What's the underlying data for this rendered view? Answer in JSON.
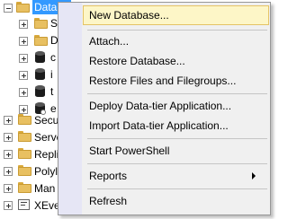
{
  "tree": {
    "selected": "Databa",
    "children_visible": [
      "S",
      "D",
      "c",
      "i",
      "t",
      "e"
    ],
    "siblings_visible": [
      "Secu",
      "Serve",
      "Repli",
      "Polyl",
      "Man",
      "XEve"
    ]
  },
  "context_menu": {
    "items": [
      {
        "label": "New Database..."
      },
      {
        "label": "Attach..."
      },
      {
        "label": "Restore Database..."
      },
      {
        "label": "Restore Files and Filegroups..."
      },
      {
        "label": "Deploy Data-tier Application..."
      },
      {
        "label": "Import Data-tier Application..."
      },
      {
        "label": "Start PowerShell"
      },
      {
        "label": "Reports"
      },
      {
        "label": "Refresh"
      }
    ],
    "highlighted_item": "New Database..."
  },
  "colors": {
    "selection": "#3399ff",
    "menu_background": "#f0f0f0",
    "highlight_background": "#fdf6c7",
    "highlight_border": "#e5c365"
  }
}
